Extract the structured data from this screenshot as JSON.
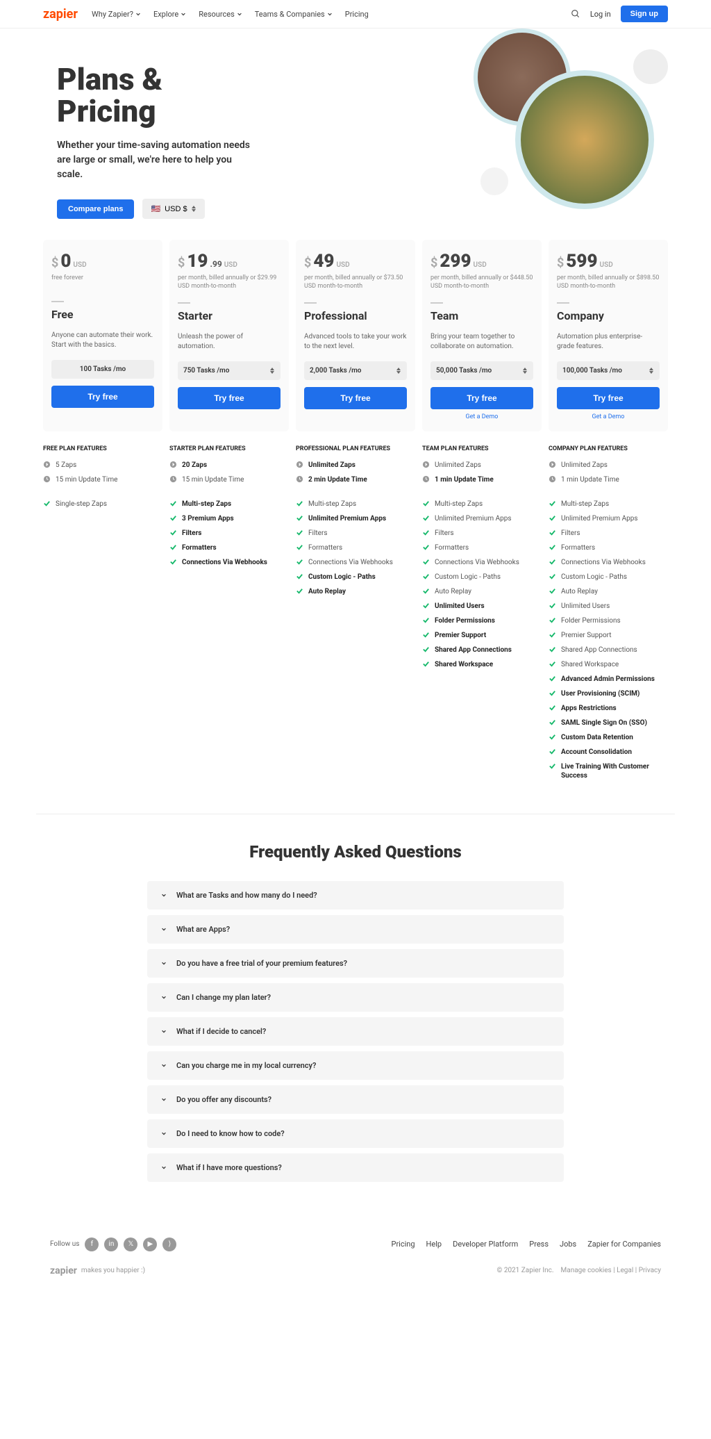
{
  "nav": {
    "items": [
      "Why Zapier?",
      "Explore",
      "Resources",
      "Teams & Companies",
      "Pricing"
    ],
    "login": "Log in",
    "signup": "Sign up"
  },
  "hero": {
    "title": "Plans & Pricing",
    "sub": "Whether your time-saving automation needs are large or small, we're here to help you scale.",
    "compare": "Compare plans",
    "currency": "USD $"
  },
  "plans": [
    {
      "dollar": "$",
      "num": "0",
      "cents": "",
      "usd": "USD",
      "bill": "free forever",
      "name": "Free",
      "desc": "Anyone can automate their work. Start with the basics.",
      "tasks": "100 Tasks /mo",
      "try": "Try free",
      "demo": "",
      "selArrow": false
    },
    {
      "dollar": "$",
      "num": "19",
      "cents": ".99",
      "usd": "USD",
      "bill": "per month, billed annually or $29.99 USD month-to-month",
      "name": "Starter",
      "desc": "Unleash the power of automation.",
      "tasks": "750 Tasks /mo",
      "try": "Try free",
      "demo": "",
      "selArrow": true
    },
    {
      "dollar": "$",
      "num": "49",
      "cents": "",
      "usd": "USD",
      "bill": "per month, billed annually or $73.50 USD month-to-month",
      "name": "Professional",
      "desc": "Advanced tools to take your work to the next level.",
      "tasks": "2,000 Tasks /mo",
      "try": "Try free",
      "demo": "",
      "selArrow": true
    },
    {
      "dollar": "$",
      "num": "299",
      "cents": "",
      "usd": "USD",
      "bill": "per month, billed annually or $448.50 USD month-to-month",
      "name": "Team",
      "desc": "Bring your team together to collaborate on automation.",
      "tasks": "50,000 Tasks /mo",
      "try": "Try free",
      "demo": "Get a Demo",
      "selArrow": true
    },
    {
      "dollar": "$",
      "num": "599",
      "cents": "",
      "usd": "USD",
      "bill": "per month, billed annually or $898.50 USD month-to-month",
      "name": "Company",
      "desc": "Automation plus enterprise-grade features.",
      "tasks": "100,000 Tasks /mo",
      "try": "Try free",
      "demo": "Get a Demo",
      "selArrow": true
    }
  ],
  "feats": [
    {
      "head": "FREE PLAN FEATURES",
      "top": [
        {
          "i": "zap",
          "t": "5 Zaps",
          "b": 0
        },
        {
          "i": "clk",
          "t": "15 min Update Time",
          "b": 0
        }
      ],
      "list": [
        {
          "t": "Single-step Zaps",
          "b": 0
        }
      ]
    },
    {
      "head": "STARTER PLAN FEATURES",
      "top": [
        {
          "i": "zap",
          "t": "20 Zaps",
          "b": 1
        },
        {
          "i": "clk",
          "t": "15 min Update Time",
          "b": 0
        }
      ],
      "list": [
        {
          "t": "Multi-step Zaps",
          "b": 1
        },
        {
          "t": "3 Premium Apps",
          "b": 1
        },
        {
          "t": "Filters",
          "b": 1
        },
        {
          "t": "Formatters",
          "b": 1
        },
        {
          "t": "Connections Via Webhooks",
          "b": 1
        }
      ]
    },
    {
      "head": "PROFESSIONAL PLAN FEATURES",
      "top": [
        {
          "i": "zap",
          "t": "Unlimited Zaps",
          "b": 1
        },
        {
          "i": "clk",
          "t": "2 min Update Time",
          "b": 1
        }
      ],
      "list": [
        {
          "t": "Multi-step Zaps",
          "b": 0
        },
        {
          "t": "Unlimited Premium Apps",
          "b": 1
        },
        {
          "t": "Filters",
          "b": 0
        },
        {
          "t": "Formatters",
          "b": 0
        },
        {
          "t": "Connections Via Webhooks",
          "b": 0
        },
        {
          "t": "Custom Logic - Paths",
          "b": 1
        },
        {
          "t": "Auto Replay",
          "b": 1
        }
      ]
    },
    {
      "head": "TEAM PLAN FEATURES",
      "top": [
        {
          "i": "zap",
          "t": "Unlimited Zaps",
          "b": 0
        },
        {
          "i": "clk",
          "t": "1 min Update Time",
          "b": 1
        }
      ],
      "list": [
        {
          "t": "Multi-step Zaps",
          "b": 0
        },
        {
          "t": "Unlimited Premium Apps",
          "b": 0
        },
        {
          "t": "Filters",
          "b": 0
        },
        {
          "t": "Formatters",
          "b": 0
        },
        {
          "t": "Connections Via Webhooks",
          "b": 0
        },
        {
          "t": "Custom Logic - Paths",
          "b": 0
        },
        {
          "t": "Auto Replay",
          "b": 0
        },
        {
          "t": "Unlimited Users",
          "b": 1
        },
        {
          "t": "Folder Permissions",
          "b": 1
        },
        {
          "t": "Premier Support",
          "b": 1
        },
        {
          "t": "Shared App Connections",
          "b": 1
        },
        {
          "t": "Shared Workspace",
          "b": 1
        }
      ]
    },
    {
      "head": "COMPANY PLAN FEATURES",
      "top": [
        {
          "i": "zap",
          "t": "Unlimited Zaps",
          "b": 0
        },
        {
          "i": "clk",
          "t": "1 min Update Time",
          "b": 0
        }
      ],
      "list": [
        {
          "t": "Multi-step Zaps",
          "b": 0
        },
        {
          "t": "Unlimited Premium Apps",
          "b": 0
        },
        {
          "t": "Filters",
          "b": 0
        },
        {
          "t": "Formatters",
          "b": 0
        },
        {
          "t": "Connections Via Webhooks",
          "b": 0
        },
        {
          "t": "Custom Logic - Paths",
          "b": 0
        },
        {
          "t": "Auto Replay",
          "b": 0
        },
        {
          "t": "Unlimited Users",
          "b": 0
        },
        {
          "t": "Folder Permissions",
          "b": 0
        },
        {
          "t": "Premier Support",
          "b": 0
        },
        {
          "t": "Shared App Connections",
          "b": 0
        },
        {
          "t": "Shared Workspace",
          "b": 0
        },
        {
          "t": "Advanced Admin Permissions",
          "b": 1
        },
        {
          "t": "User Provisioning (SCIM)",
          "b": 1
        },
        {
          "t": "Apps Restrictions",
          "b": 1
        },
        {
          "t": "SAML Single Sign On (SSO)",
          "b": 1
        },
        {
          "t": "Custom Data Retention",
          "b": 1
        },
        {
          "t": "Account Consolidation",
          "b": 1
        },
        {
          "t": "Live Training With Customer Success",
          "b": 1
        }
      ]
    }
  ],
  "faq": {
    "title": "Frequently Asked Questions",
    "qs": [
      "What are Tasks and how many do I need?",
      "What are Apps?",
      "Do you have a free trial of your premium features?",
      "Can I change my plan later?",
      "What if I decide to cancel?",
      "Can you charge me in my local currency?",
      "Do you offer any discounts?",
      "Do I need to know how to code?",
      "What if I have more questions?"
    ]
  },
  "footer": {
    "follow": "Follow us",
    "links": [
      "Pricing",
      "Help",
      "Developer Platform",
      "Press",
      "Jobs",
      "Zapier for Companies"
    ],
    "tag": "makes you happier :)",
    "copy": "© 2021 Zapier Inc.",
    "legal": [
      "Manage cookies",
      "Legal",
      "Privacy"
    ]
  }
}
